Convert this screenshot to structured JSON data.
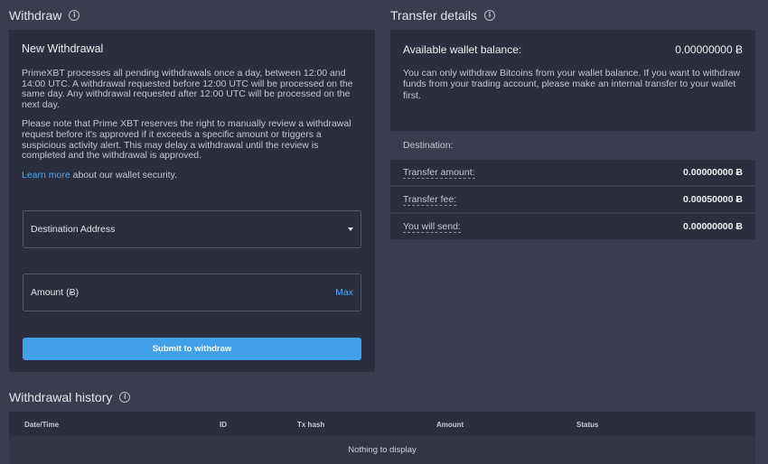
{
  "withdraw": {
    "title": "Withdraw",
    "heading": "New Withdrawal",
    "para1": "PrimeXBT processes all pending withdrawals once a day, between 12:00 and 14:00 UTC. A withdrawal requested before 12:00 UTC will be processed on the same day. Any withdrawal requested after 12:00 UTC will be processed on the next day.",
    "para2": "Please note that Prime XBT reserves the right to manually review a withdrawal request before it's approved if it exceeds a specific amount or triggers a suspicious activity alert. This may delay a withdrawal until the review is completed and the withdrawal is approved.",
    "learn_more_link": "Learn more",
    "learn_more_rest": " about our wallet security.",
    "destination_label": "Destination Address",
    "amount_label": "Amount (Ƀ)",
    "max_label": "Max",
    "submit_label": "Submit to withdraw"
  },
  "transfer": {
    "title": "Transfer details",
    "balance_label": "Available wallet balance:",
    "balance_value": "0.00000000 Ƀ",
    "balance_note": "You can only withdraw Bitcoins from your wallet balance. If you want to withdraw funds from your trading account, please make an internal transfer to your wallet first.",
    "rows": [
      {
        "label": "Destination:",
        "value": ""
      },
      {
        "label": "Transfer amount:",
        "value": "0.00000000 Ƀ"
      },
      {
        "label": "Transfer fee:",
        "value": "0.00050000 Ƀ"
      },
      {
        "label": "You will send:",
        "value": "0.00000000 Ƀ"
      }
    ]
  },
  "history": {
    "title": "Withdrawal history",
    "columns": [
      "Date/Time",
      "ID",
      "Tx hash",
      "Amount",
      "Status"
    ],
    "empty_text": "Nothing to display"
  },
  "icons": {
    "info": "info-icon",
    "dropdown": "chevron-down-icon"
  },
  "colors": {
    "accent": "#41a0ea",
    "link": "#4aa9f0",
    "panel": "#2b2e3e",
    "background": "#3a3d4f"
  }
}
